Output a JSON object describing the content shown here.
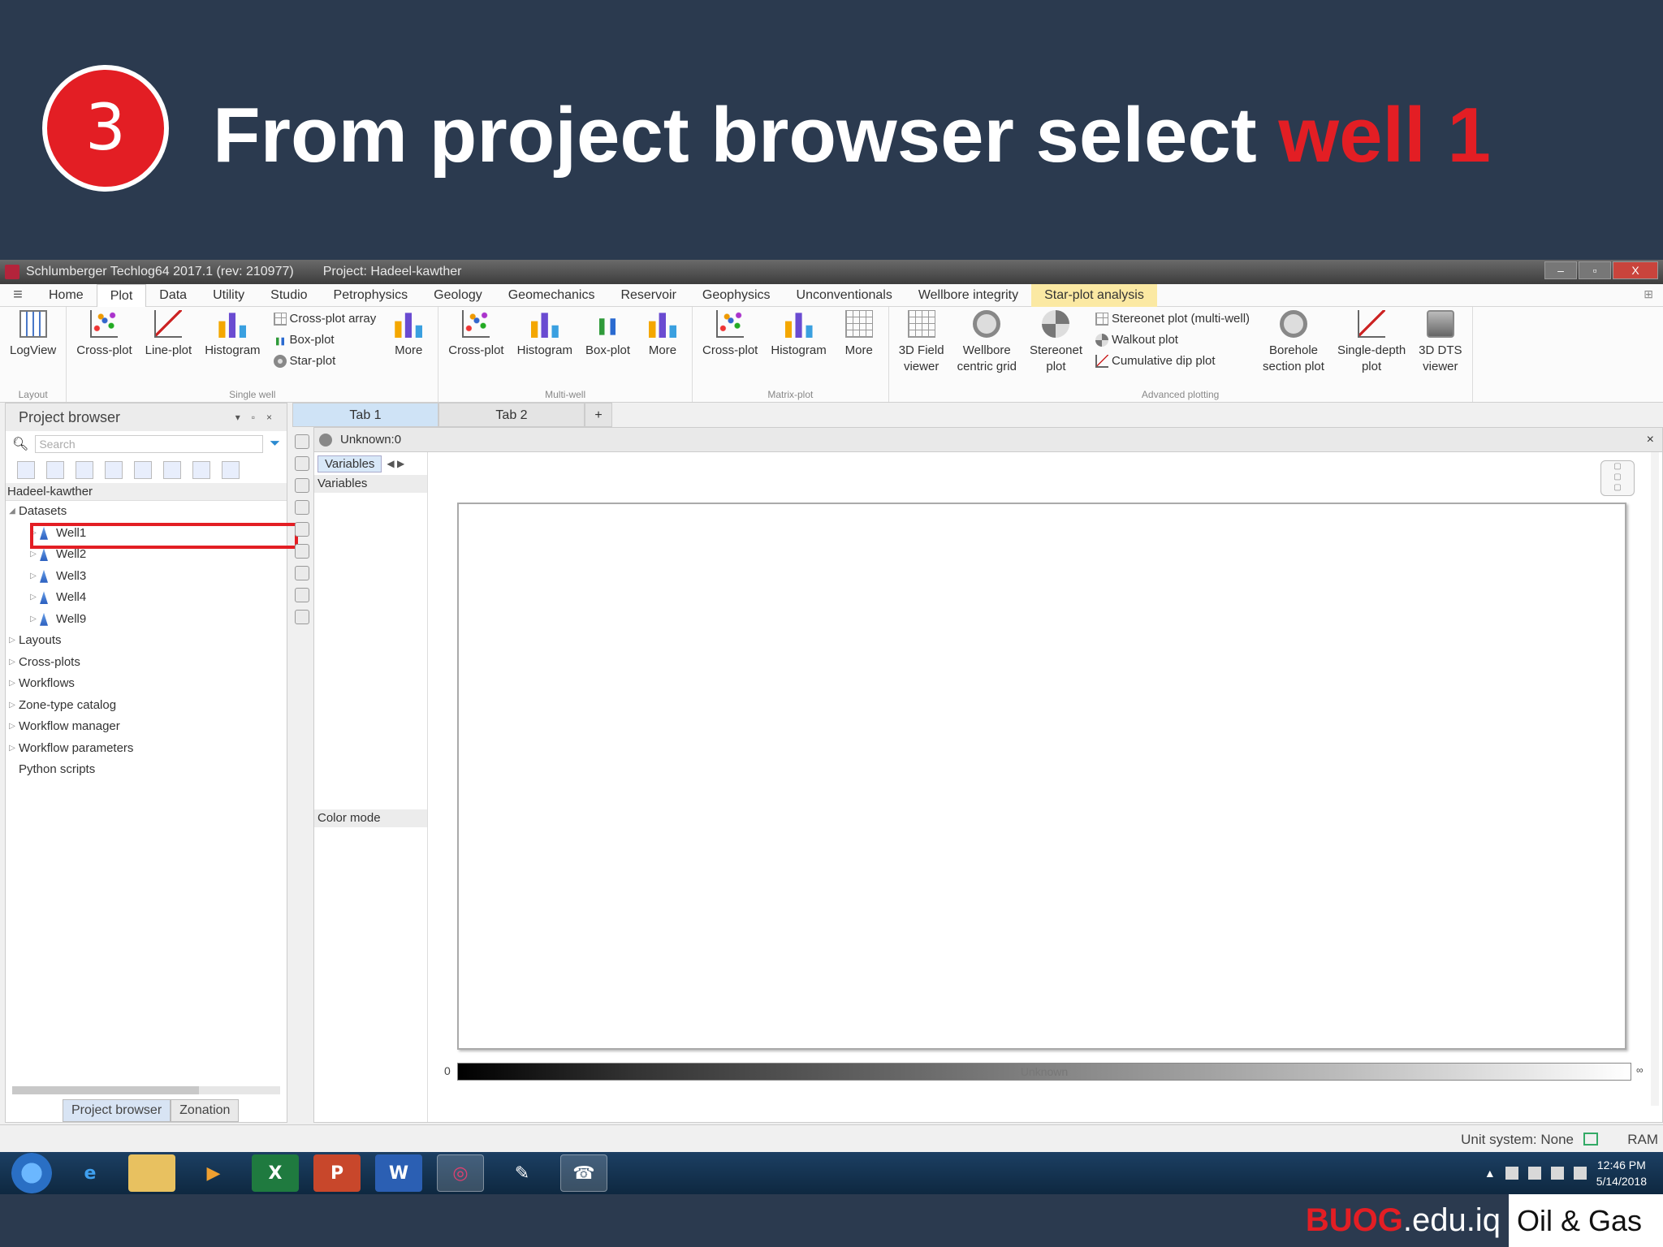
{
  "slide": {
    "step_number": "3",
    "title_prefix": "From project browser select ",
    "title_highlight": "well 1"
  },
  "window": {
    "app_title": "Schlumberger Techlog64 2017.1 (rev: 210977)",
    "project_title": "Project: Hadeel-kawther",
    "min": "–",
    "max": "▫",
    "close": "X"
  },
  "menu": {
    "tabs": [
      "Home",
      "Plot",
      "Data",
      "Utility",
      "Studio",
      "Petrophysics",
      "Geology",
      "Geomechanics",
      "Reservoir",
      "Geophysics",
      "Unconventionals",
      "Wellbore integrity",
      "Star-plot analysis"
    ],
    "active_tab": "Plot"
  },
  "ribbon": {
    "layout": {
      "label": "Layout",
      "logview": "LogView"
    },
    "single_well": {
      "label": "Single well",
      "crossplot": "Cross-plot",
      "lineplot": "Line-plot",
      "histogram": "Histogram",
      "crossplot_array": "Cross-plot array",
      "boxplot": "Box-plot",
      "starplot": "Star-plot",
      "more": "More"
    },
    "multi_well": {
      "label": "Multi-well",
      "crossplot": "Cross-plot",
      "histogram": "Histogram",
      "boxplot": "Box-plot",
      "more": "More"
    },
    "matrix_plot": {
      "label": "Matrix-plot",
      "crossplot": "Cross-plot",
      "histogram": "Histogram",
      "more": "More"
    },
    "advanced": {
      "label": "Advanced plotting",
      "field_viewer_1": "3D Field",
      "field_viewer_2": "viewer",
      "wellbore_1": "Wellbore",
      "wellbore_2": "centric grid",
      "stereonet_1": "Stereonet",
      "stereonet_2": "plot",
      "stereonet_multi": "Stereonet plot (multi-well)",
      "walkout": "Walkout plot",
      "cumulative_dip": "Cumulative dip plot",
      "borehole_1": "Borehole",
      "borehole_2": "section plot",
      "single_depth_1": "Single-depth",
      "single_depth_2": "plot",
      "dts_1": "3D DTS",
      "dts_2": "viewer"
    }
  },
  "browser": {
    "title": "Project browser",
    "search_placeholder": "Search",
    "project_name": "Hadeel-kawther",
    "datasets_label": "Datasets",
    "wells": [
      "Well1",
      "Well2",
      "Well3",
      "Well4",
      "Well9"
    ],
    "selected_well": "Well1",
    "other_nodes": [
      "Layouts",
      "Cross-plots",
      "Workflows",
      "Zone-type catalog",
      "Workflow manager",
      "Workflow parameters",
      "Python scripts"
    ],
    "bottom_tabs": [
      "Project browser",
      "Zonation"
    ]
  },
  "doc_tabs": [
    "Tab 1",
    "Tab 2",
    "+"
  ],
  "plot": {
    "title": "Unknown:0",
    "variables_tab": "Variables",
    "variables_header": "Variables",
    "color_mode": "Color mode",
    "colorbar_label": "Unknown",
    "colorbar_min": "0",
    "colorbar_max": "∞"
  },
  "status": {
    "unit_system": "Unit system: None",
    "ram": "RAM"
  },
  "taskbar": {
    "apps": [
      "e",
      "",
      "▶",
      "X",
      "P",
      "W",
      "◎",
      "✎",
      "☎"
    ],
    "time": "12:46 PM",
    "date": "5/14/2018"
  },
  "footer": {
    "brand_red": "BUOG",
    "brand_rest": ".edu.iq",
    "tag": "Oil & Gas"
  },
  "colors": {
    "slide_bg": "#2b3a4f",
    "accent_red": "#e31e24",
    "highlight_tab": "#fbe9a3"
  }
}
